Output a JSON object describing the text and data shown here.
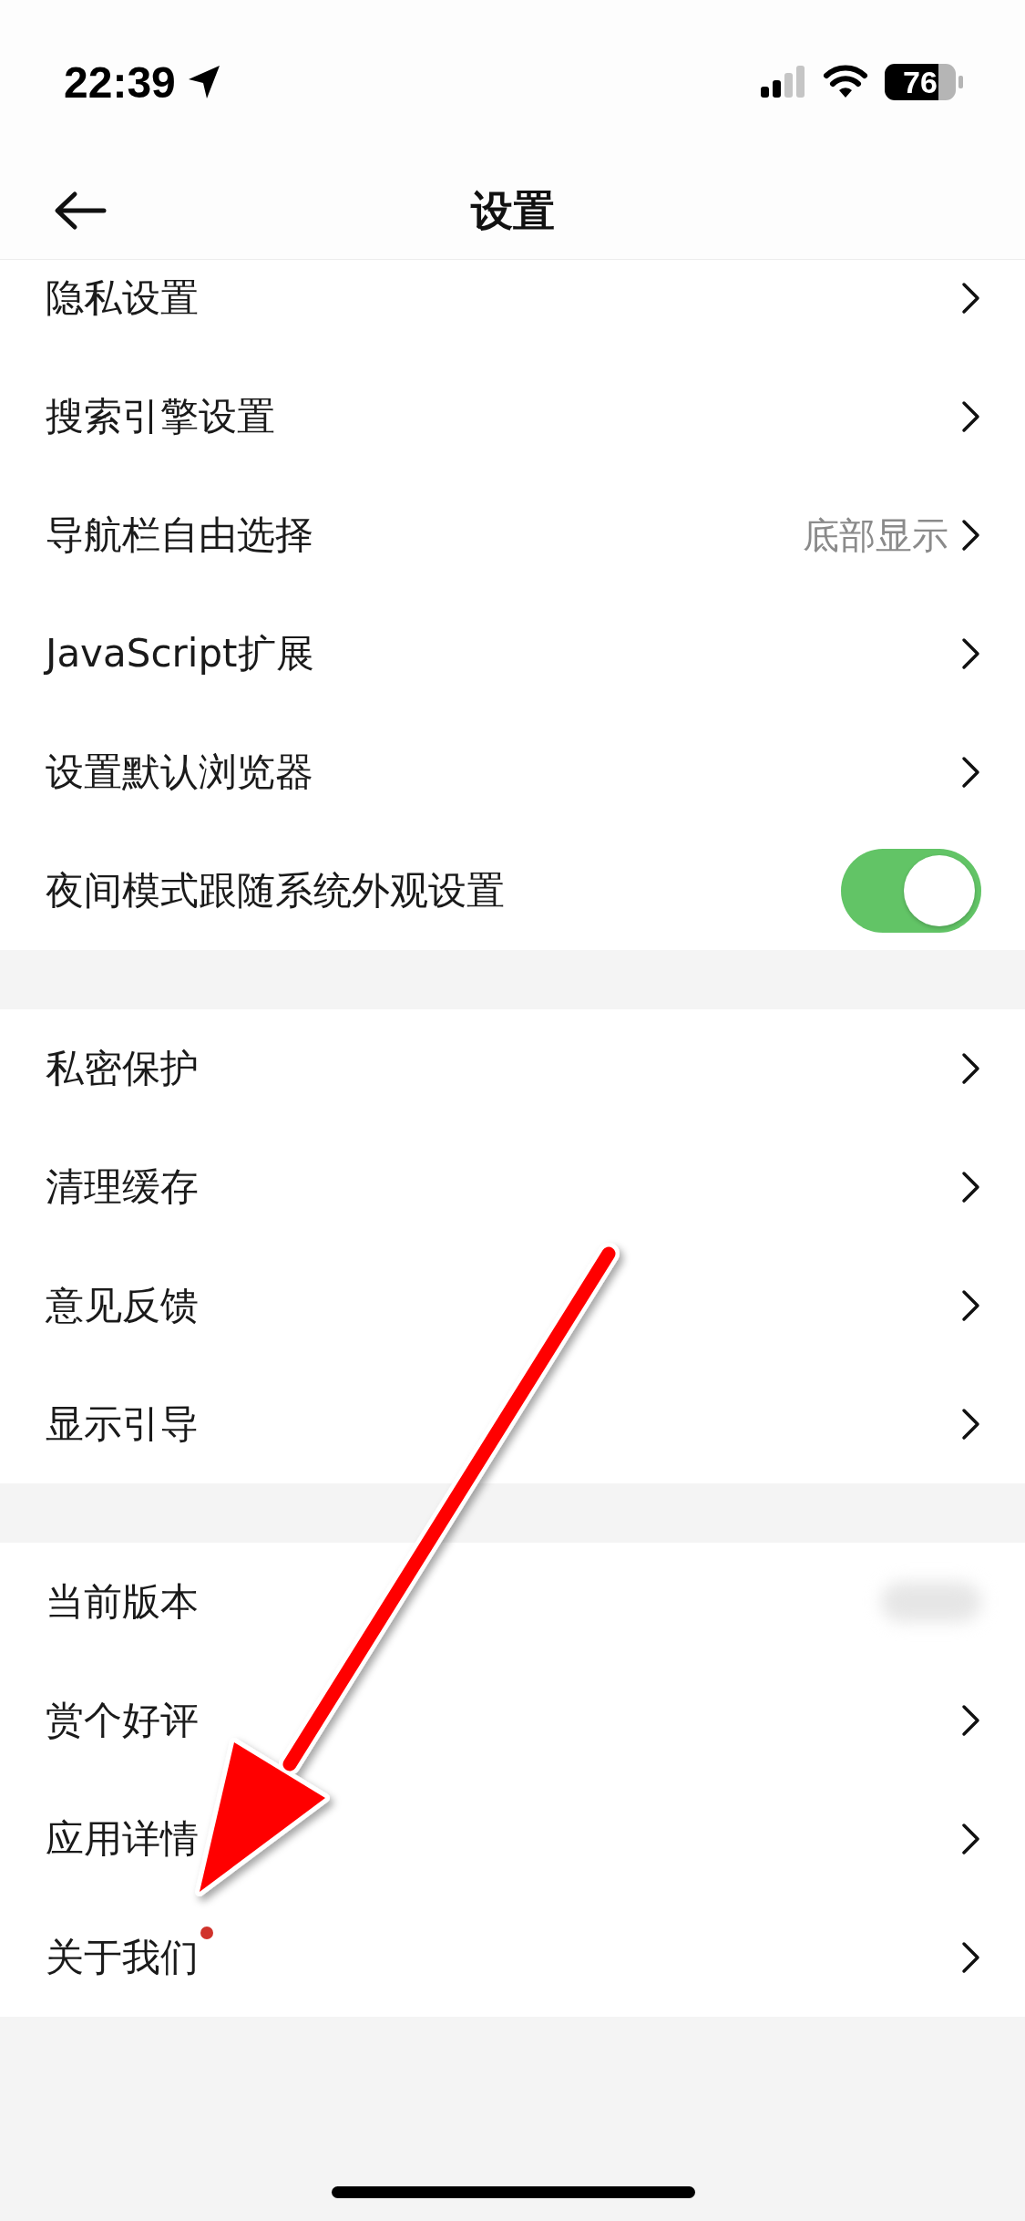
{
  "status_bar": {
    "time": "22:39",
    "battery": "76"
  },
  "nav": {
    "title": "设置"
  },
  "groups": [
    {
      "rows": [
        {
          "label": "隐私设置",
          "kind": "link",
          "dot": false
        },
        {
          "label": "搜索引擎设置",
          "kind": "link",
          "dot": false
        },
        {
          "label": "导航栏自由选择",
          "kind": "link",
          "value": "底部显示",
          "dot": false
        },
        {
          "label": "JavaScript扩展",
          "kind": "link",
          "dot": false
        },
        {
          "label": "设置默认浏览器",
          "kind": "link",
          "dot": false
        },
        {
          "label": "夜间模式跟随系统外观设置",
          "kind": "toggle",
          "on": true,
          "dot": false
        }
      ]
    },
    {
      "rows": [
        {
          "label": "私密保护",
          "kind": "link",
          "dot": false
        },
        {
          "label": "清理缓存",
          "kind": "link",
          "dot": false
        },
        {
          "label": "意见反馈",
          "kind": "link",
          "dot": false
        },
        {
          "label": "显示引导",
          "kind": "link",
          "dot": false
        }
      ]
    },
    {
      "rows": [
        {
          "label": "当前版本",
          "kind": "info",
          "dot": false
        },
        {
          "label": "赏个好评",
          "kind": "link",
          "dot": false
        },
        {
          "label": "应用详情",
          "kind": "link",
          "dot": false
        },
        {
          "label": "关于我们",
          "kind": "link",
          "dot": true
        }
      ]
    }
  ]
}
